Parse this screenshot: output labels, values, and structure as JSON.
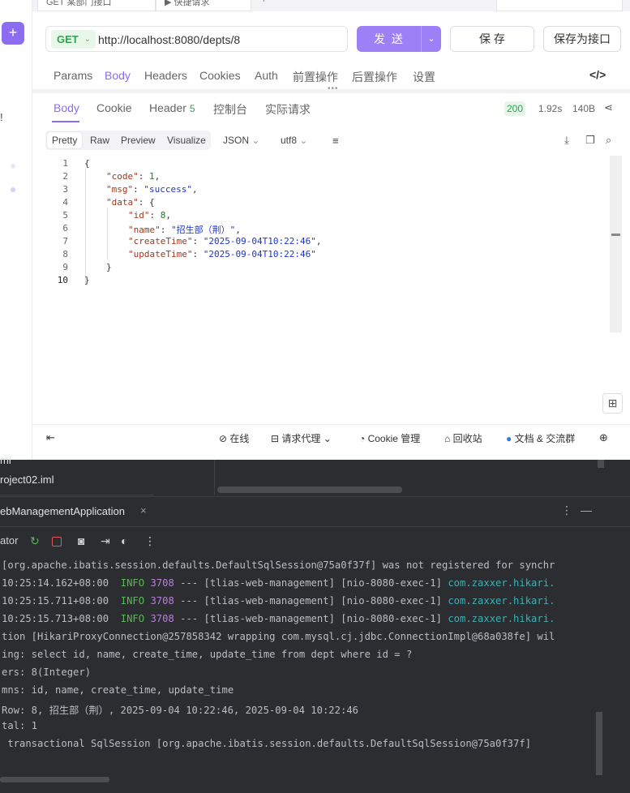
{
  "tabs": {
    "tab1": "GET 某部门接口",
    "tab2": "▶ 快捷请求",
    "tab3": "+"
  },
  "request": {
    "method": "GET",
    "url": "http://localhost:8080/depts/8",
    "send_label": "发 送",
    "save_label": "保 存",
    "save_as_label": "保存为接口"
  },
  "request_tabs": [
    "Params",
    "Body",
    "Headers",
    "Cookies",
    "Auth",
    "前置操作",
    "后置操作",
    "设置"
  ],
  "response_tabs": {
    "body": "Body",
    "cookie": "Cookie",
    "header": "Header",
    "header_count": "5",
    "console": "控制台",
    "actual": "实际请求"
  },
  "response_meta": {
    "status": "200",
    "time": "1.92s",
    "size": "140B"
  },
  "format_tabs": [
    "Pretty",
    "Raw",
    "Preview",
    "Visualize"
  ],
  "format_select": "JSON",
  "encoding_select": "utf8",
  "code_lines": {
    "l1": "{",
    "l2a": "\"code\"",
    "l2b": ": ",
    "l2c": "1",
    "l2d": ",",
    "l3a": "\"msg\"",
    "l3b": ": ",
    "l3c": "\"success\"",
    "l3d": ",",
    "l4a": "\"data\"",
    "l4b": ": {",
    "l5a": "\"id\"",
    "l5b": ": ",
    "l5c": "8",
    "l5d": ",",
    "l6a": "\"name\"",
    "l6b": ": ",
    "l6c": "\"招生部（荆）\"",
    "l6d": ",",
    "l7a": "\"createTime\"",
    "l7b": ": ",
    "l7c": "\"2025-09-04T10:22:46\"",
    "l7d": ",",
    "l8a": "\"updateTime\"",
    "l8b": ": ",
    "l8c": "\"2025-09-04T10:22:46\"",
    "l9": "}",
    "l10": "}"
  },
  "line_numbers": [
    "1",
    "2",
    "3",
    "4",
    "5",
    "6",
    "7",
    "8",
    "9",
    "10"
  ],
  "status_bar": {
    "online": "在线",
    "proxy": "请求代理",
    "cookie": "Cookie 管理",
    "recycle": "回收站",
    "docs": "文档 & 交流群"
  },
  "ide": {
    "file1": "ml",
    "file2": "roject02.iml",
    "run_title": "ebManagementApplication",
    "toolbar_label": "ator"
  },
  "console_lines": [
    {
      "a": "[org.apache.ibatis.session.defaults.DefaultSqlSession@75a0f37f] was not registered for synchr"
    },
    {
      "t": "10:25:14.162+08:00  ",
      "lvl": "INFO",
      "pid": " 3708",
      "mid": " --- [tlias-web-management] [nio-8080-exec-1] ",
      "cls": "com.zaxxer.hikari."
    },
    {
      "t": "10:25:15.711+08:00  ",
      "lvl": "INFO",
      "pid": " 3708",
      "mid": " --- [tlias-web-management] [nio-8080-exec-1] ",
      "cls": "com.zaxxer.hikari."
    },
    {
      "t": "10:25:15.713+08:00  ",
      "lvl": "INFO",
      "pid": " 3708",
      "mid": " --- [tlias-web-management] [nio-8080-exec-1] ",
      "cls": "com.zaxxer.hikari."
    },
    {
      "a": "tion [HikariProxyConnection@257858342 wrapping com.mysql.cj.jdbc.ConnectionImpl@68a038fe] wil"
    },
    {
      "a": "ing: select id, name, create_time, update_time from dept where id = ?"
    },
    {
      "a": "ers: 8(Integer)"
    },
    {
      "a": "mns: id, name, create_time, update_time"
    },
    {
      "a": "Row: 8, 招生部（荆）, 2025-09-04 10:22:46, 2025-09-04 10:22:46"
    },
    {
      "a": "tal: 1"
    },
    {
      "a": " transactional SqlSession [org.apache.ibatis.session.defaults.DefaultSqlSession@75a0f37f]"
    }
  ]
}
